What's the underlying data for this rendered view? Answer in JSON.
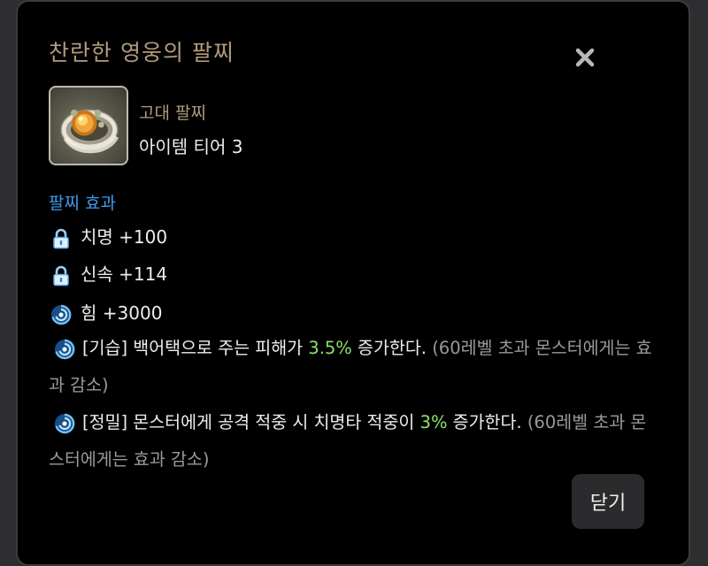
{
  "dialog": {
    "title": "찬란한 영웅의 팔찌",
    "close_button_label": "닫기"
  },
  "item": {
    "grade": "고대 팔찌",
    "tier": "아이템 티어 3"
  },
  "effects": {
    "section_title": "팔찌 효과",
    "stats": [
      {
        "icon": "lock-icon",
        "text": "치명 +100"
      },
      {
        "icon": "lock-icon",
        "text": "신속 +114"
      },
      {
        "icon": "swirl-icon",
        "text": "힘 +3000"
      }
    ],
    "special": [
      {
        "icon": "swirl-icon",
        "before": "[기습] 백어택으로 주는 피해가 ",
        "value": "3.5%",
        "after": " 증가한다. ",
        "note": "(60레벨 초과 몬스터에게는 효과 감소)"
      },
      {
        "icon": "swirl-icon",
        "before": "[정밀] 몬스터에게 공격 적중 시 치명타 적중이 ",
        "value": "3%",
        "after": " 증가한다. ",
        "note": "(60레벨 초과 몬스터에게는 효과 감소)"
      }
    ]
  },
  "colors": {
    "title": "#b39a7d",
    "section": "#3e9bea",
    "highlight": "#8ee06a",
    "muted": "#9a9a9a"
  }
}
